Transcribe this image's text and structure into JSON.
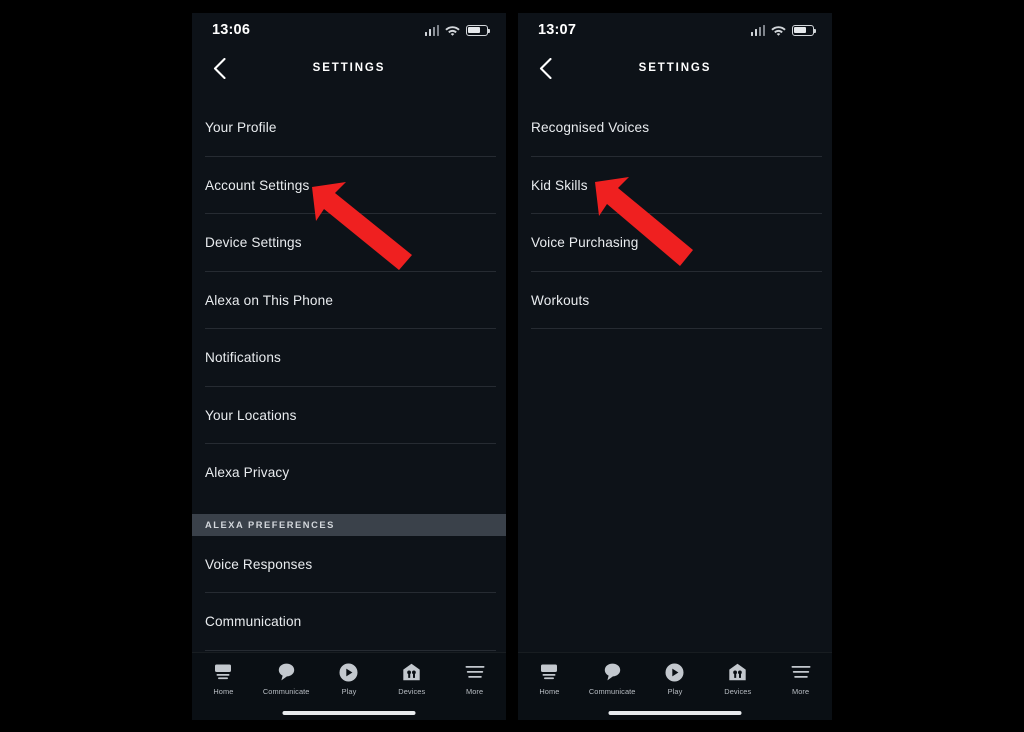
{
  "screens": [
    {
      "id": "screen-left",
      "status_bar": {
        "time": "13:06",
        "signal_icon": "cellular-signal-icon",
        "wifi_icon": "wifi-icon",
        "battery_icon": "battery-icon"
      },
      "nav": {
        "back_icon": "chevron-left-icon",
        "title": "SETTINGS"
      },
      "items": [
        {
          "label": "Your Profile",
          "type": "row"
        },
        {
          "label": "Account Settings",
          "type": "row"
        },
        {
          "label": "Device Settings",
          "type": "row"
        },
        {
          "label": "Alexa on This Phone",
          "type": "row"
        },
        {
          "label": "Notifications",
          "type": "row"
        },
        {
          "label": "Your Locations",
          "type": "row"
        },
        {
          "label": "Alexa Privacy",
          "type": "row",
          "no_separator": true
        },
        {
          "label": "ALEXA PREFERENCES",
          "type": "section"
        },
        {
          "label": "Voice Responses",
          "type": "row"
        },
        {
          "label": "Communication",
          "type": "row"
        }
      ],
      "tabs": [
        {
          "label": "Home",
          "icon": "home-echo-device-icon"
        },
        {
          "label": "Communicate",
          "icon": "speech-bubble-icon"
        },
        {
          "label": "Play",
          "icon": "play-circle-icon"
        },
        {
          "label": "Devices",
          "icon": "devices-house-icon"
        },
        {
          "label": "More",
          "icon": "hamburger-menu-icon"
        }
      ],
      "annotation": {
        "type": "red-arrow",
        "points_to": "Account Settings"
      }
    },
    {
      "id": "screen-right",
      "status_bar": {
        "time": "13:07",
        "signal_icon": "cellular-signal-icon",
        "wifi_icon": "wifi-icon",
        "battery_icon": "battery-icon"
      },
      "nav": {
        "back_icon": "chevron-left-icon",
        "title": "SETTINGS"
      },
      "items": [
        {
          "label": "Recognised Voices",
          "type": "row"
        },
        {
          "label": "Kid Skills",
          "type": "row"
        },
        {
          "label": "Voice Purchasing",
          "type": "row"
        },
        {
          "label": "Workouts",
          "type": "row"
        }
      ],
      "tabs": [
        {
          "label": "Home",
          "icon": "home-echo-device-icon"
        },
        {
          "label": "Communicate",
          "icon": "speech-bubble-icon"
        },
        {
          "label": "Play",
          "icon": "play-circle-icon"
        },
        {
          "label": "Devices",
          "icon": "devices-house-icon"
        },
        {
          "label": "More",
          "icon": "hamburger-menu-icon"
        }
      ],
      "annotation": {
        "type": "red-arrow",
        "points_to": "Kid Skills"
      }
    }
  ],
  "colors": {
    "page_background": "#000000",
    "screen_background": "#0d1218",
    "section_header_background": "#3a414a",
    "primary_text": "#e9ecef",
    "annotation_red": "#ef2020"
  }
}
